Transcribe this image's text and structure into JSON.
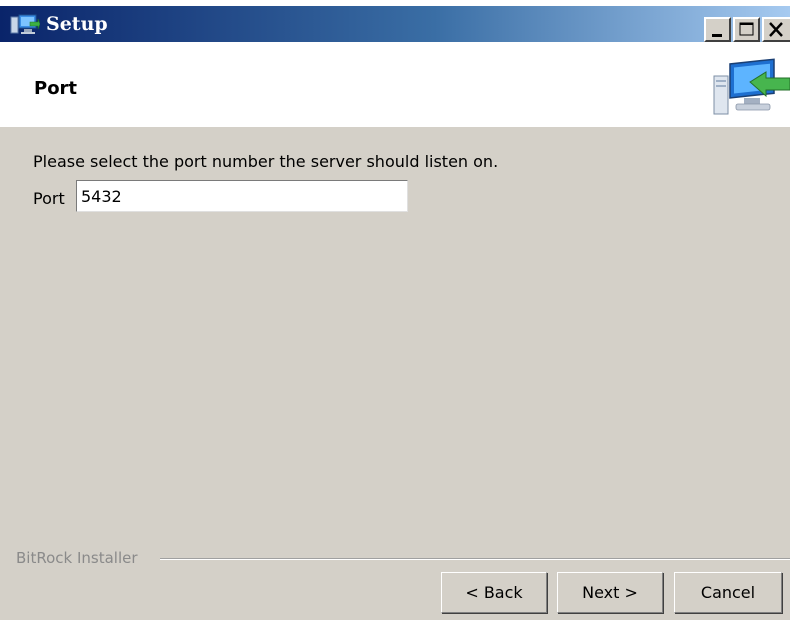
{
  "window": {
    "title": "Setup",
    "controls": {
      "minimize": "minimize",
      "maximize": "maximize",
      "close": "close"
    }
  },
  "header": {
    "title": "Port"
  },
  "content": {
    "instruction": "Please select the port number the server should listen on.",
    "port_label": "Port",
    "port_value": "5432"
  },
  "footer": {
    "brand": "BitRock Installer",
    "back_label": "< Back",
    "next_label": "Next >",
    "cancel_label": "Cancel"
  },
  "colors": {
    "titlebar_start": "#0a246a",
    "titlebar_end": "#a6caf0",
    "dialog_bg": "#d4d0c8",
    "header_bg": "#ffffff"
  },
  "icons": {
    "app": "installer-computer-icon",
    "header": "computer-with-green-arrow-icon"
  }
}
